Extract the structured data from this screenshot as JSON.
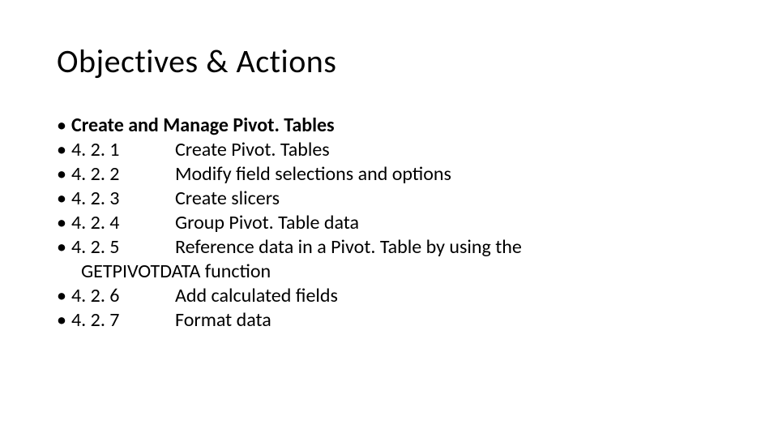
{
  "title": "Objectives & Actions",
  "heading": "Create and Manage Pivot. Tables",
  "items": [
    {
      "num": "4. 2. 1",
      "text": "Create Pivot. Tables"
    },
    {
      "num": "4. 2. 2",
      "text": "Modify field selections and options"
    },
    {
      "num": "4. 2. 3",
      "text": "Create slicers"
    },
    {
      "num": "4. 2. 4",
      "text": "Group Pivot. Table data"
    },
    {
      "num": "4. 2. 5",
      "text": "Reference data in a Pivot. Table by using the"
    },
    {
      "num": "4. 2. 6",
      "text": "Add calculated fields"
    },
    {
      "num": "4. 2. 7",
      "text": "Format data"
    }
  ],
  "wrap_line": "GETPIVOTDATA function",
  "bullet_char": "•"
}
